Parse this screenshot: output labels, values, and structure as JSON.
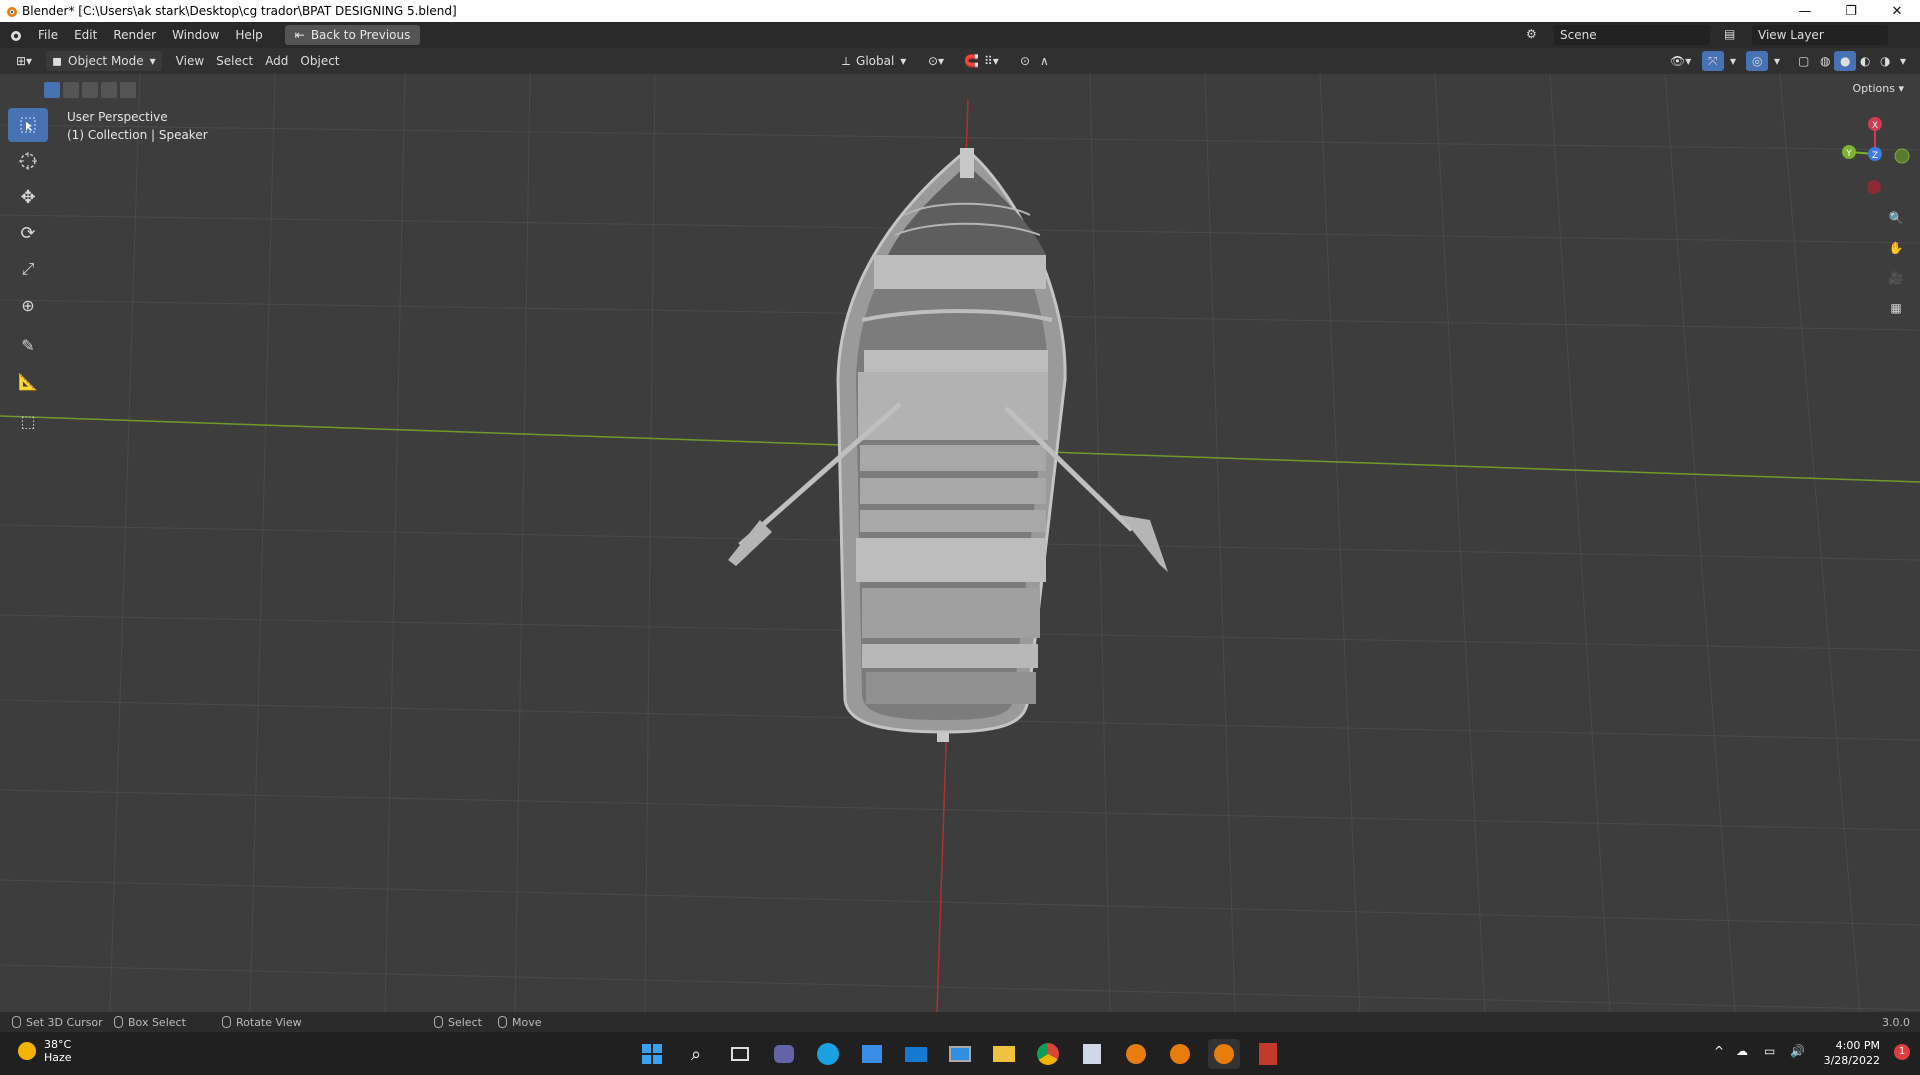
{
  "window": {
    "title": "Blender* [C:\\Users\\ak stark\\Desktop\\cg trador\\BPAT DESIGNING 5.blend]",
    "minimize": "—",
    "maximize": "❐",
    "close": "✕"
  },
  "menu": {
    "items": [
      "File",
      "Edit",
      "Render",
      "Window",
      "Help"
    ],
    "back_label": "Back to Previous",
    "scene_label": "Scene",
    "view_layer_label": "View Layer"
  },
  "header": {
    "mode": "Object Mode",
    "menus": [
      "View",
      "Select",
      "Add",
      "Object"
    ],
    "orientation": "Global",
    "options_label": "Options"
  },
  "viewport": {
    "perspective": "User Perspective",
    "collection": "(1) Collection | Speaker",
    "gizmo": {
      "x": "X",
      "y": "Y",
      "z": "Z"
    }
  },
  "status": {
    "cursor": "Set 3D Cursor",
    "box_select": "Box Select",
    "rotate": "Rotate View",
    "select": "Select",
    "move": "Move",
    "version": "3.0.0"
  },
  "taskbar": {
    "temp": "38°C",
    "weather": "Haze",
    "time": "4:00 PM",
    "date": "3/28/2022",
    "badge": "1"
  },
  "colors": {
    "accent": "#4772b3",
    "x_axis": "#d43b4f",
    "y_axis": "#7ab330",
    "z_axis": "#3d7be0"
  }
}
